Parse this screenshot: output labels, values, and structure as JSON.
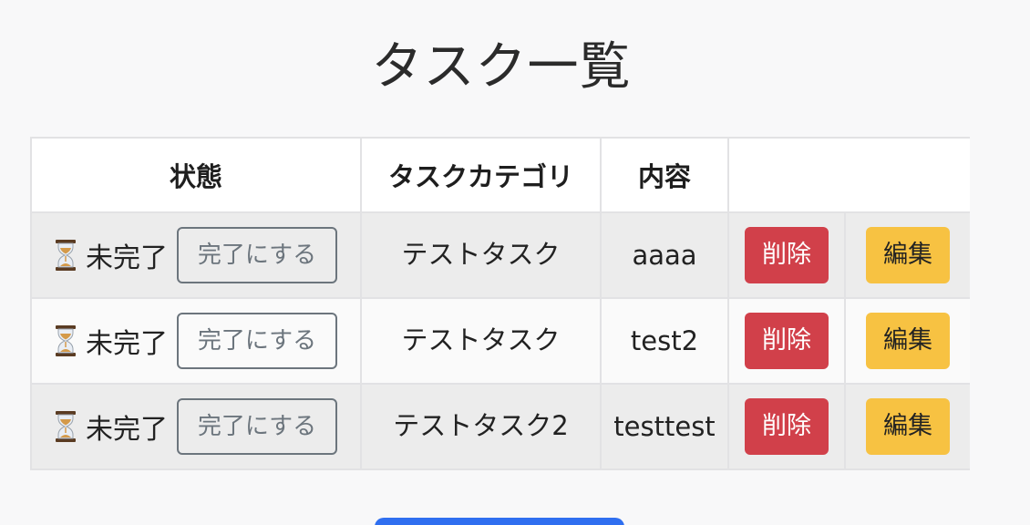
{
  "page": {
    "title": "タスク一覧"
  },
  "table": {
    "headers": {
      "status": "状態",
      "category": "タスクカテゴリ",
      "content": "内容",
      "actions": ""
    },
    "rows": [
      {
        "status": "未完了",
        "complete_label": "完了にする",
        "category": "テストタスク",
        "content": "aaaa",
        "delete_label": "削除",
        "edit_label": "編集"
      },
      {
        "status": "未完了",
        "complete_label": "完了にする",
        "category": "テストタスク",
        "content": "test2",
        "delete_label": "削除",
        "edit_label": "編集"
      },
      {
        "status": "未完了",
        "complete_label": "完了にする",
        "category": "テストタスク2",
        "content": "testtest",
        "delete_label": "削除",
        "edit_label": "編集"
      }
    ]
  },
  "icons": {
    "status": "hourglass-icon"
  },
  "colors": {
    "danger": "#d1404a",
    "warning": "#f7c242",
    "primary": "#2f6ff0",
    "secondary": "#6c757d"
  }
}
